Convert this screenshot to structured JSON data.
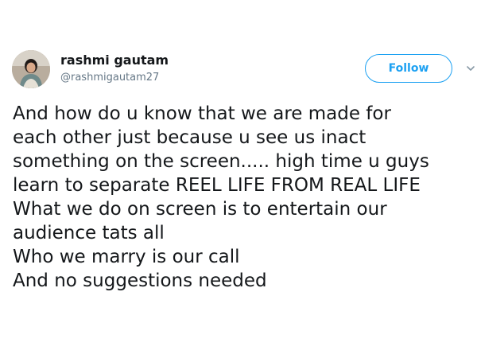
{
  "tweet": {
    "author": {
      "display_name": "rashmi gautam",
      "handle": "@rashmigautam27",
      "avatar_icon": "profile-photo"
    },
    "follow_label": "Follow",
    "menu_icon": "chevron-down-icon",
    "text_lines": [
      "And how do u know that we are made for",
      "each other just because u see us inact",
      "something on the screen..... high time u guys",
      "learn to separate REEL LIFE FROM REAL LIFE",
      "What we do on screen is to entertain our",
      "audience tats all",
      "Who we marry is our call",
      "And no suggestions needed"
    ]
  },
  "colors": {
    "accent": "#1da1f2",
    "text": "#14171a",
    "secondary_text": "#657786"
  }
}
